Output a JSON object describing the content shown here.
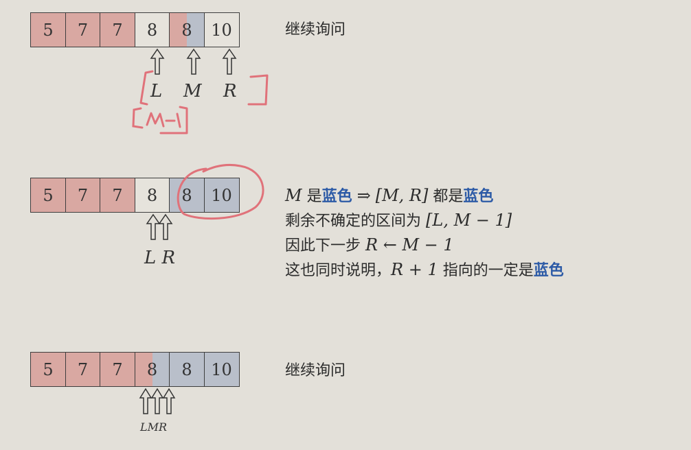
{
  "rows": [
    {
      "cells": [
        "5",
        "7",
        "7",
        "8",
        "8",
        "10"
      ],
      "labels": [
        "L",
        "M",
        "R"
      ],
      "text": "继续询问"
    },
    {
      "cells": [
        "5",
        "7",
        "7",
        "8",
        "8",
        "10"
      ],
      "label": "L R",
      "lines": {
        "l1_a": "M",
        "l1_b": "是",
        "l1_c": "蓝色",
        "l1_d": "⇒",
        "l1_e": "[M, R]",
        "l1_f": "都是",
        "l1_g": "蓝色",
        "l2_a": "剩余不确定的区间为",
        "l2_b": "[L, M − 1]",
        "l3_a": "因此下一步",
        "l3_b": "R ← M − 1",
        "l4_a": "这也同时说明，",
        "l4_b": "R + 1",
        "l4_c": "指向的一定是",
        "l4_d": "蓝色"
      }
    },
    {
      "cells": [
        "5",
        "7",
        "7",
        "8",
        "8",
        "10"
      ],
      "label": "LMR",
      "text": "继续询问"
    }
  ],
  "colors": {
    "red": "#d9a8a2",
    "blue": "#b9bfca",
    "white": "#e6e3dc",
    "highlight_text": "#2c5aa6",
    "ink": "#e0727a"
  }
}
